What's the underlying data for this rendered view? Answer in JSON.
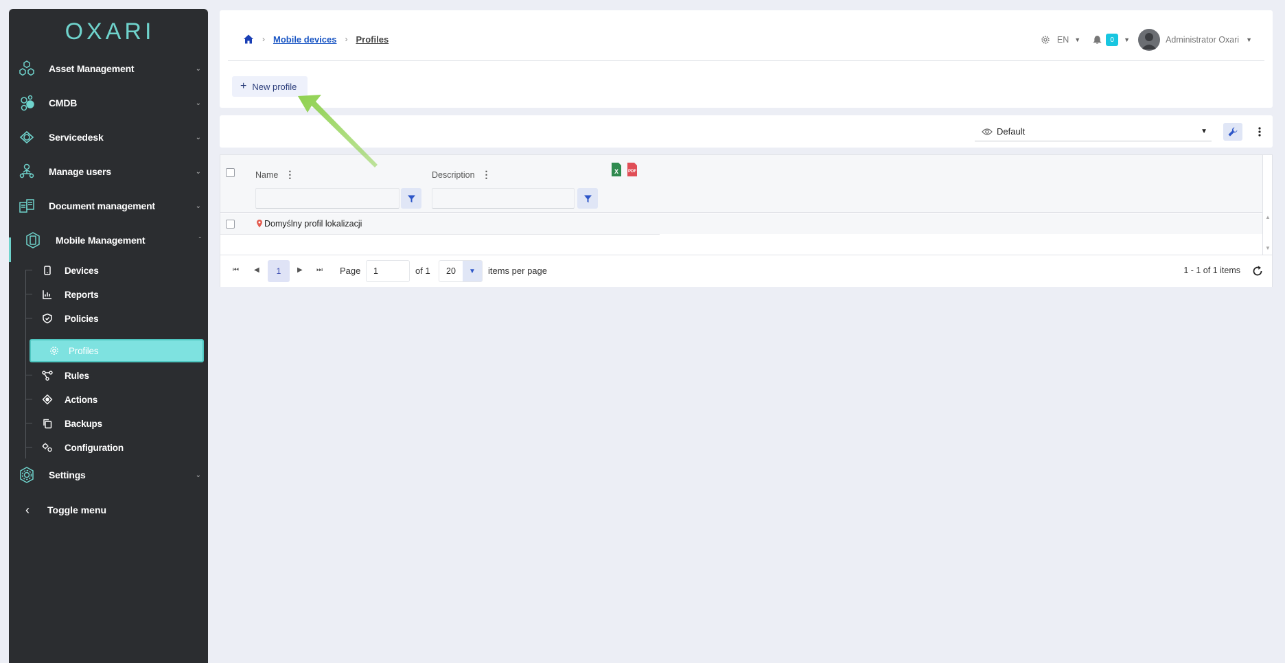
{
  "brand": {
    "logo_text": "OXARI",
    "accent": "#6fd3cc"
  },
  "sidebar": {
    "items": [
      {
        "label": "Asset Management",
        "icon": "hexagons-icon"
      },
      {
        "label": "CMDB",
        "icon": "cubes-icon"
      },
      {
        "label": "Servicedesk",
        "icon": "headset-icon"
      },
      {
        "label": "Manage users",
        "icon": "users-icon"
      },
      {
        "label": "Document management",
        "icon": "documents-icon"
      },
      {
        "label": "Mobile Management",
        "icon": "mobile-icon",
        "expanded": true
      },
      {
        "label": "Settings",
        "icon": "gear-icon"
      }
    ],
    "subitems": [
      {
        "label": "Devices",
        "icon": "phone-icon"
      },
      {
        "label": "Reports",
        "icon": "chart-icon"
      },
      {
        "label": "Policies",
        "icon": "shield-icon"
      },
      {
        "label": "Profiles",
        "icon": "gear-icon",
        "selected": true
      },
      {
        "label": "Rules",
        "icon": "flow-icon"
      },
      {
        "label": "Actions",
        "icon": "target-icon"
      },
      {
        "label": "Backups",
        "icon": "copy-icon"
      },
      {
        "label": "Configuration",
        "icon": "gears-icon"
      }
    ],
    "toggle_label": "Toggle menu"
  },
  "header": {
    "breadcrumb": [
      "Mobile devices",
      "Profiles"
    ],
    "language": "EN",
    "notification_count": "0",
    "user_name": "Administrator Oxari",
    "new_button": "New profile"
  },
  "toolbar": {
    "view_name": "Default"
  },
  "grid": {
    "columns": [
      "Name",
      "Description"
    ],
    "rows": [
      {
        "name": "Domyślny profil lokalizacji",
        "description": ""
      }
    ]
  },
  "pager": {
    "current_page": "1",
    "page_label": "Page",
    "page_value": "1",
    "of_label": "of 1",
    "page_size": "20",
    "items_per_page_label": "items per page",
    "summary": "1 - 1 of 1 items"
  }
}
